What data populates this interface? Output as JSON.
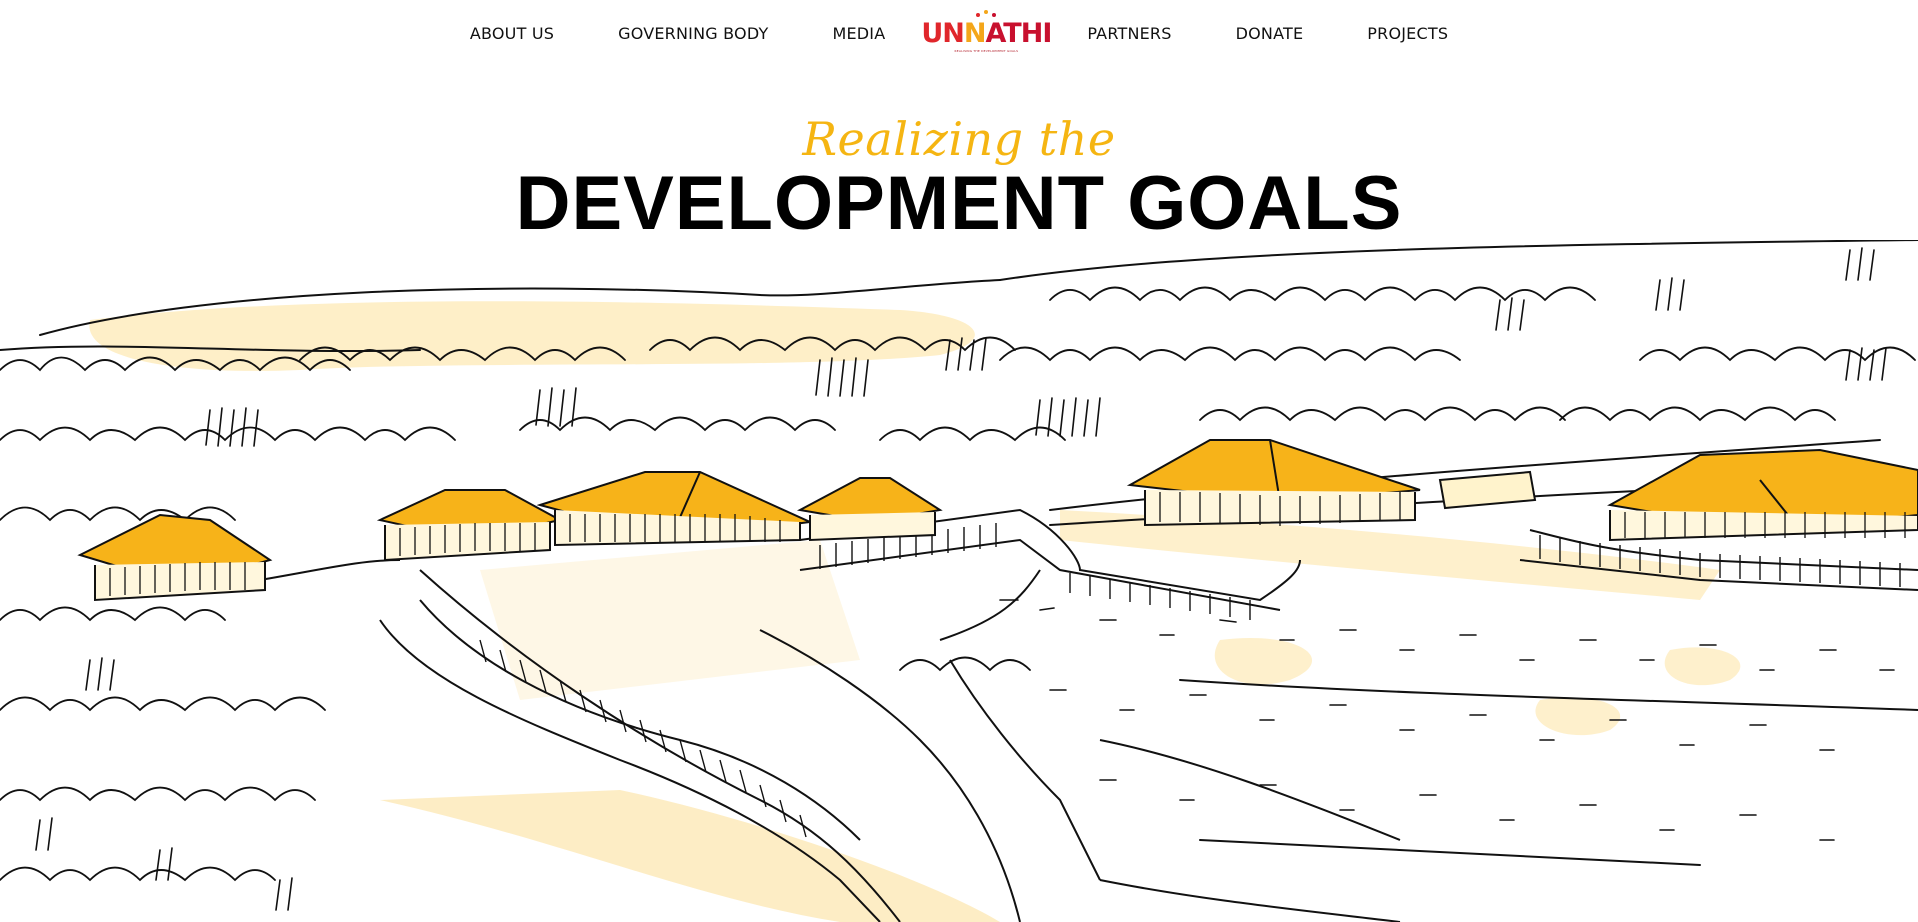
{
  "nav": {
    "left": [
      "ABOUT US",
      "GOVERNING BODY",
      "MEDIA"
    ],
    "right": [
      "PARTNERS",
      "DONATE",
      "PROJECTS"
    ],
    "logo": {
      "part1": "UN",
      "part2": "N",
      "part3": "ATHI",
      "tagline": "REALISING THE DEVELOPMENT GOALS"
    }
  },
  "hero": {
    "subtitle": "Realizing the",
    "title": "DEVELOPMENT GOALS"
  },
  "colors": {
    "accent": "#f5b512",
    "roof": "#f7b319",
    "wash": "#fde9b6",
    "logo_red": "#e0262b",
    "text": "#111111"
  }
}
